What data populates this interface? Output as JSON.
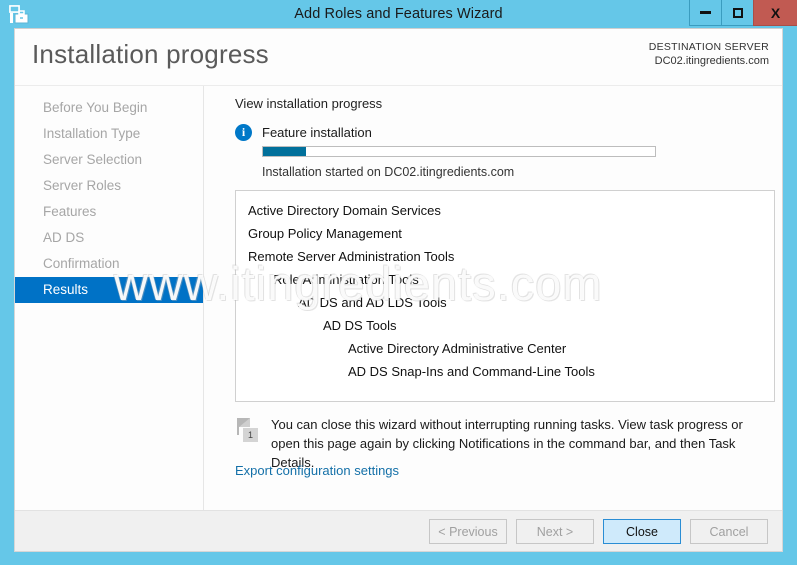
{
  "window": {
    "title": "Add Roles and Features Wizard",
    "app_icon": "server-wizard-icon",
    "controls": {
      "minimize": "minimize-icon",
      "maximize": "maximize-icon",
      "close": "X"
    }
  },
  "header": {
    "page_title": "Installation progress",
    "destination_label": "DESTINATION SERVER",
    "destination_server": "DC02.itingredients.com"
  },
  "sidebar": {
    "items": [
      {
        "label": "Before You Begin",
        "active": false
      },
      {
        "label": "Installation Type",
        "active": false
      },
      {
        "label": "Server Selection",
        "active": false
      },
      {
        "label": "Server Roles",
        "active": false
      },
      {
        "label": "Features",
        "active": false
      },
      {
        "label": "AD DS",
        "active": false
      },
      {
        "label": "Confirmation",
        "active": false
      },
      {
        "label": "Results",
        "active": true
      }
    ]
  },
  "main": {
    "section_label": "View installation progress",
    "info_icon": "info-icon",
    "info_text": "Feature installation",
    "progress_percent": 11,
    "progress_status": "Installation started on DC02.itingredients.com",
    "installed_items": [
      {
        "label": "Active Directory Domain Services",
        "indent": 0
      },
      {
        "label": "Group Policy Management",
        "indent": 0
      },
      {
        "label": "Remote Server Administration Tools",
        "indent": 0
      },
      {
        "label": "Role Administration Tools",
        "indent": 1
      },
      {
        "label": "AD DS and AD LDS Tools",
        "indent": 2
      },
      {
        "label": "AD DS Tools",
        "indent": 3
      },
      {
        "label": "Active Directory Administrative Center",
        "indent": 4
      },
      {
        "label": "AD DS Snap-Ins and Command-Line Tools",
        "indent": 4
      }
    ],
    "note_badge": "1",
    "note_text": "You can close this wizard without interrupting running tasks. View task progress or open this page again by clicking Notifications in the command bar, and then Task Details.",
    "export_link": "Export configuration settings"
  },
  "footer": {
    "buttons": [
      {
        "label": "< Previous",
        "state": "disabled",
        "name": "previous-button"
      },
      {
        "label": "Next >",
        "state": "disabled",
        "name": "next-button"
      },
      {
        "label": "Close",
        "state": "default",
        "name": "close-button"
      },
      {
        "label": "Cancel",
        "state": "disabled",
        "name": "cancel-button"
      }
    ]
  },
  "watermark": {
    "text": "www.itingredients.com"
  },
  "colors": {
    "title_bar": "#65c7e8",
    "accent_blue": "#0072c6",
    "progress_fill": "#01709b",
    "link_blue": "#1470a8",
    "close_button_red": "#c15a52"
  }
}
